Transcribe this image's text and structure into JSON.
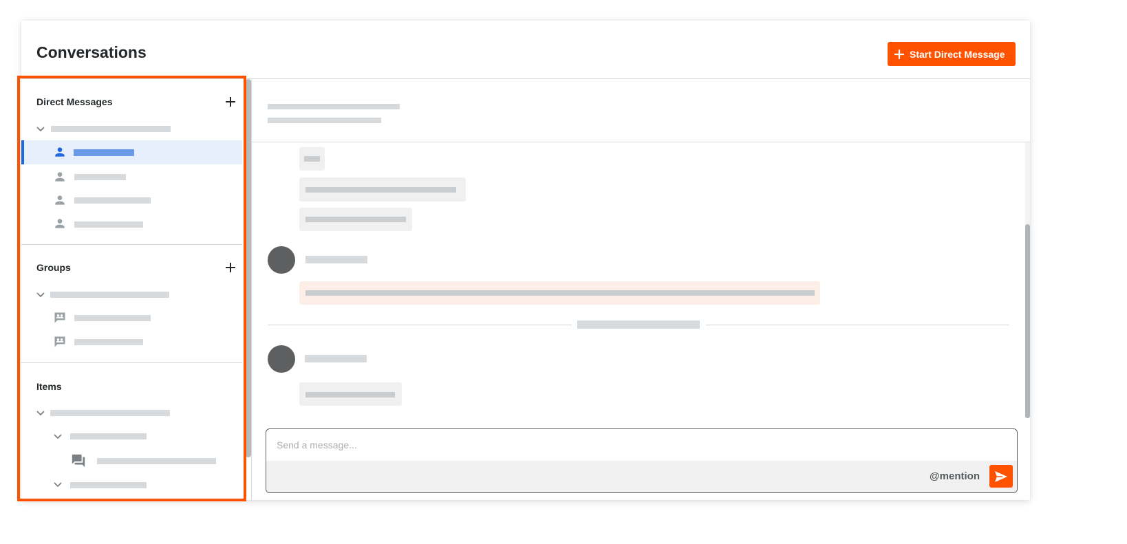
{
  "header": {
    "title": "Conversations",
    "start_dm_label": "Start Direct Message"
  },
  "sidebar": {
    "sections": [
      {
        "title": "Direct Messages",
        "has_add": true
      },
      {
        "title": "Groups",
        "has_add": true
      },
      {
        "title": "Items",
        "has_add": false
      }
    ]
  },
  "composer": {
    "placeholder": "Send a message...",
    "mention_label": "@mention"
  },
  "icons": {
    "add": "plus-icon",
    "collapse": "chevron-down-icon",
    "direct_message": "person-icon",
    "group": "group-chat-icon",
    "item": "forum-icon",
    "send": "send-icon"
  },
  "colors": {
    "accent": "#ff5200",
    "selected_row": "#e8effc",
    "selected_indicator": "#2066df",
    "skeleton": "#d6dadc"
  }
}
